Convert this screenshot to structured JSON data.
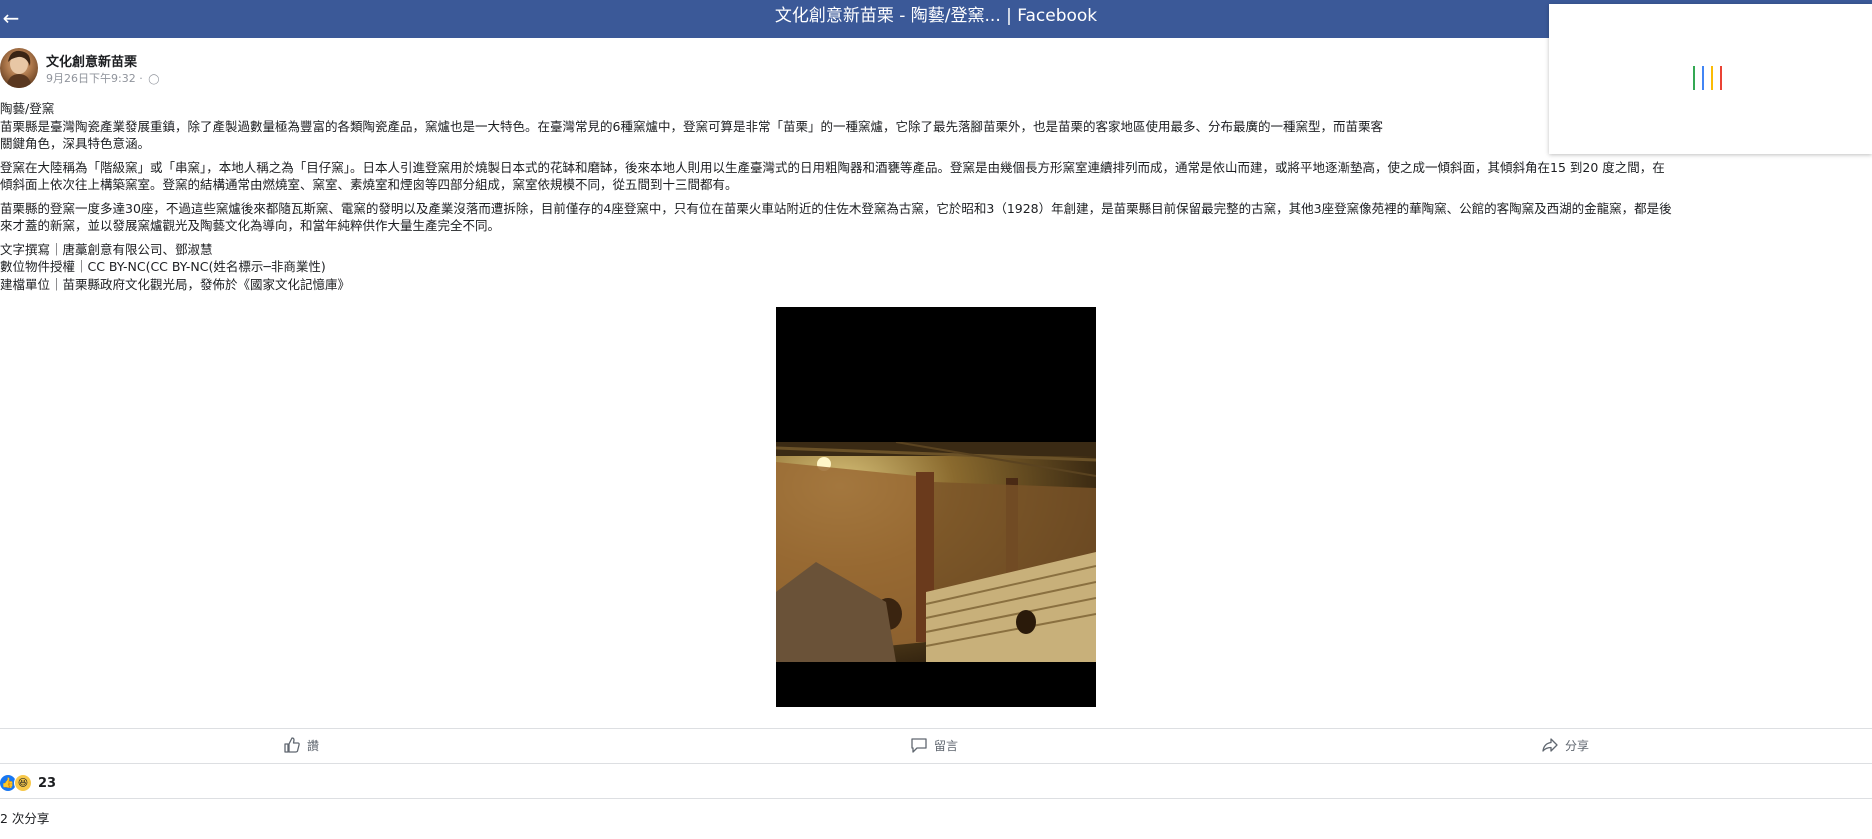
{
  "top_bar": {
    "title": "文化創意新苗栗 - 陶藝/登窯... | Facebook",
    "background": "#3b5998"
  },
  "loader_colors": [
    "#34a853",
    "#4285f4",
    "#fbbc05",
    "#ea4335"
  ],
  "post": {
    "author": "文化創意新苗栗",
    "timestamp": "9月26日下午9:32 ·",
    "privacy_icon": "globe-icon",
    "paragraphs": [
      [
        "陶藝/登窯",
        "苗栗縣是臺灣陶瓷產業發展重鎮，除了產製過數量極為豐富的各類陶瓷產品，窯爐也是一大特色。在臺灣常見的6種窯爐中，登窯可算是非常「苗栗」的一種窯爐，它除了最先落腳苗栗外，也是苗栗的客家地區使用最多、分布最廣的一種窯型，而苗栗客",
        "關鍵角色，深具特色意涵。"
      ],
      [
        "登窯在大陸稱為「階級窯」或「串窯」，本地人稱之為「目仔窯」。日本人引進登窯用於燒製日本式的花缽和磨缽，後來本地人則用以生產臺灣式的日用粗陶器和酒甕等產品。登窯是由幾個長方形窯室連續排列而成，通常是依山而建，或將平地逐漸墊高，使之成一傾斜面，其傾斜角在15 到20 度之間，在",
        "傾斜面上依次往上構築窯室。登窯的結構通常由燃燒室、窯室、素燒室和煙囪等四部分組成，窯室依規模不同，從五間到十三間都有。"
      ],
      [
        "苗栗縣的登窯一度多達30座，不過這些窯爐後來都隨瓦斯窯、電窯的發明以及產業沒落而遭拆除，目前僅存的4座登窯中，只有位在苗栗火車站附近的住佐木登窯為古窯，它於昭和3（1928）年創建，是苗栗縣目前保留最完整的古窯，其他3座登窯像苑裡的華陶窯、公館的客陶窯及西湖的金龍窯，都是後",
        "來才蓋的新窯，並以發展窯爐觀光及陶藝文化為導向，和當年純粹供作大量生產完全不同。"
      ],
      [
        "文字撰寫｜唐藁創意有限公司、鄧淑慧",
        "數位物件授權｜CC BY-NC(CC BY-NC(姓名標示─非商業性)",
        "建檔單位｜苗栗縣政府文化觀光局，發佈於《國家文化記憶庫》"
      ]
    ],
    "photo_alt": "登窯"
  },
  "actions": {
    "like_label": "讚",
    "comment_label": "留言",
    "share_label": "分享"
  },
  "reactions": {
    "count": "23"
  },
  "shares_text": "2 次分享"
}
